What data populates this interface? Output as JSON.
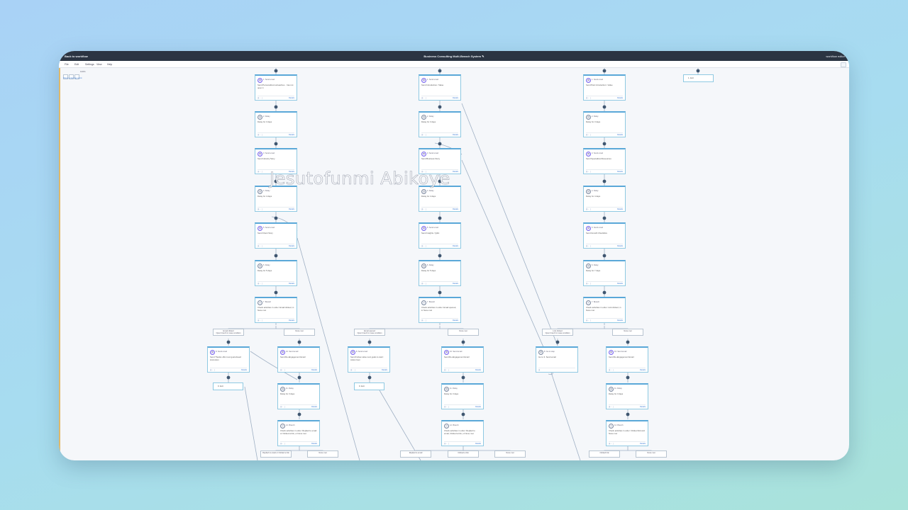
{
  "window": {
    "back_link": "Back to workflow",
    "title": "Business Consulting Multi-Branch System",
    "edit_icon": "pencil-icon",
    "user": "workflow editor"
  },
  "menu": [
    {
      "label": "File"
    },
    {
      "label": "Edit"
    },
    {
      "label": "Settings"
    },
    {
      "label": "View"
    },
    {
      "label": "Help"
    }
  ],
  "canvas": {
    "zoom_label": "100%",
    "link_text": "Show entering point"
  },
  "labels": {
    "send_email": "Send email",
    "delay": "Delay",
    "branch": "Branch",
    "exit": "Exit",
    "details": "Details",
    "none_met": "None met",
    "open_branch": "Open branch in case condition"
  },
  "column1": {
    "steps": [
      {
        "head": "1. Send email",
        "body": "Send Personalized outreaches... has not open it"
      },
      {
        "head": "2. Delay",
        "body": "Delay for 3 days"
      },
      {
        "head": "3. Send email",
        "body": "Send Industry Story"
      },
      {
        "head": "4. Delay",
        "body": "Delay for 4 days"
      },
      {
        "head": "5. Send email",
        "body": "Send Client Story"
      },
      {
        "head": "6. Delay",
        "body": "Delay for 5 days"
      },
      {
        "head": "7. Branch",
        "body": "Check activities in order: Email clicked, in None met"
      }
    ],
    "branch_a": "Email clicked",
    "branch_b": "None met",
    "sub_a": {
      "head": "8. Send email",
      "body": "Send Thanks offer next goal ahead: instruction"
    },
    "sub_a_exit": "9. Exit",
    "sub_b": [
      {
        "head": "10. Send email",
        "body": "Send Re-Engagement Email"
      },
      {
        "head": "11. Delay",
        "body": "Delay for 3 days"
      },
      {
        "head": "12. Branch",
        "body": "Check activities in order: Replied to email or Clicked a link, or None met"
      }
    ],
    "branch_c": "Replied to email or Clicked a link",
    "branch_d": "None met"
  },
  "column2": {
    "steps": [
      {
        "head": "1. Send email",
        "body": "Send Introduction / Value"
      },
      {
        "head": "2. Delay",
        "body": "Delay for 3 days"
      },
      {
        "head": "3. Send email",
        "body": "Send Business Story"
      },
      {
        "head": "4. Delay",
        "body": "Delay for 4 days"
      },
      {
        "head": "5. Send email",
        "body": "Send Insights / Q&A"
      },
      {
        "head": "6. Delay",
        "body": "Delay for 5 days"
      },
      {
        "head": "7. Branch",
        "body": "Check activities in order: Email opened, in None met"
      }
    ],
    "branch_a": "Email opened",
    "branch_b": "None met",
    "sub_a": {
      "head": "8. Send email",
      "body": "Send Follow value next goals to start: Action Item"
    },
    "sub_a_exit": "9. Exit",
    "sub_b": [
      {
        "head": "10. Send email",
        "body": "Send Re-Engagement Email"
      },
      {
        "head": "11. Delay",
        "body": "Delay for 3 days"
      },
      {
        "head": "12. Branch",
        "body": "Check activities in order: Replied to email, Clicked a link, or None met"
      }
    ],
    "branch_c": "Replied to email",
    "branch_d": "Clicked a link",
    "branch_e": "None met"
  },
  "column3": {
    "steps": [
      {
        "head": "1. Send email",
        "body": "Send Pain Introduction / Value"
      },
      {
        "head": "2. Delay",
        "body": "Delay for 3 days"
      },
      {
        "head": "3. Send email",
        "body": "Send Specialized Resources"
      },
      {
        "head": "4. Delay",
        "body": "Delay for 4 days"
      },
      {
        "head": "5. Send email",
        "body": "Send Growth Checklists"
      },
      {
        "head": "6. Delay",
        "body": "Delay for 7 days"
      },
      {
        "head": "7. Branch",
        "body": "Check activities in order: Link clicked, in None met"
      }
    ],
    "branch_a": "Link clicked",
    "branch_b": "None met",
    "sub_a": {
      "head": "8. Go to step",
      "body": "Go to 3. Send email"
    },
    "sub_b": [
      {
        "head": "10. Send email",
        "body": "Send Re-Engagement Email"
      },
      {
        "head": "11. Delay",
        "body": "Delay for 3 days"
      },
      {
        "head": "12. Branch",
        "body": "Check activities in order: Clicked link and None met"
      }
    ],
    "branch_c": "Clicked link",
    "branch_d": "None met"
  },
  "column4": {
    "exit": "1. Exit"
  },
  "watermark": "Jesutofunmi Abikoye",
  "colors": {
    "accent": "#5aa8d8",
    "titlebar": "#2b3442",
    "wire": "#9fb0c4"
  }
}
